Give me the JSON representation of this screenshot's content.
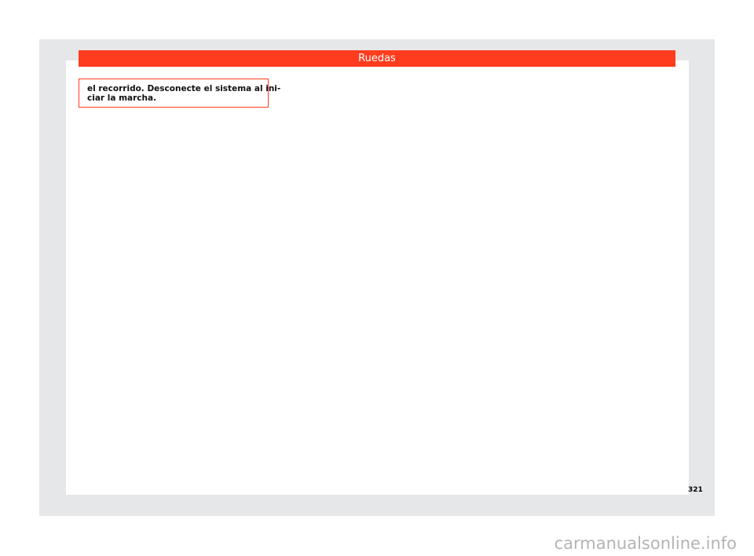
{
  "header": {
    "title": "Ruedas"
  },
  "warning": {
    "line1": "el recorrido. Desconecte el sistema al ini-",
    "line2": "ciar la marcha."
  },
  "footer": {
    "page_number": "321"
  },
  "watermark": {
    "text": "carmanualsonline.info"
  },
  "colors": {
    "accent": "#ff3d1e",
    "frame": "#e6e7e8"
  }
}
